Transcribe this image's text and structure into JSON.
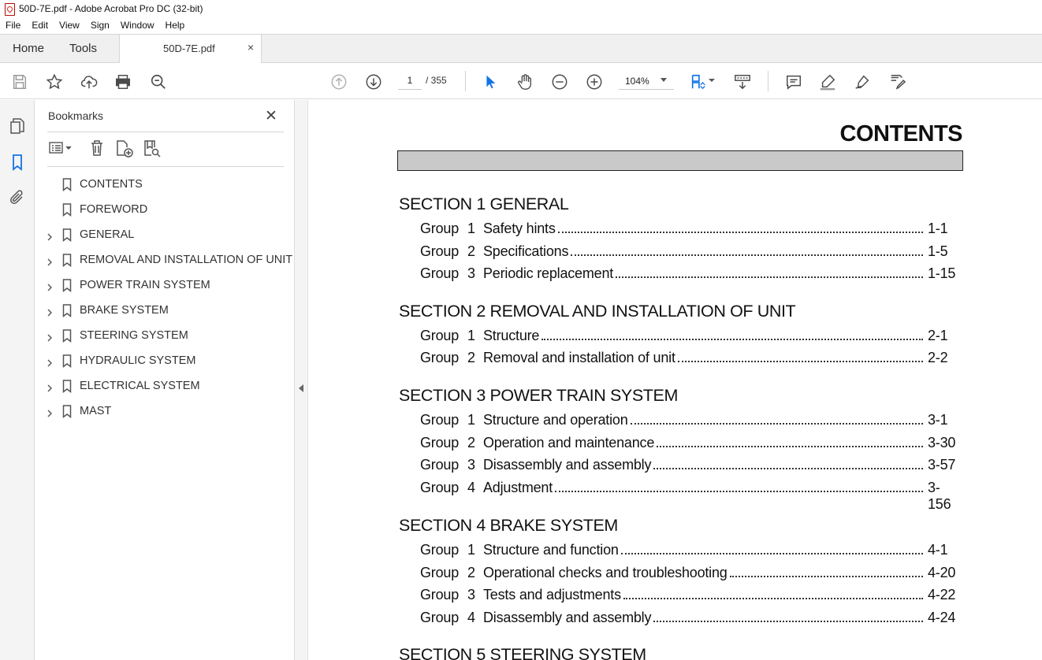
{
  "window": {
    "title": "50D-7E.pdf - Adobe Acrobat Pro DC (32-bit)"
  },
  "menu": [
    "File",
    "Edit",
    "View",
    "Sign",
    "Window",
    "Help"
  ],
  "tabs": {
    "home": "Home",
    "tools": "Tools",
    "document": "50D-7E.pdf",
    "close_glyph": "×"
  },
  "toolbar": {
    "page_current": "1",
    "page_total": "/ 355",
    "zoom": "104%",
    "icons": [
      "save-icon",
      "star-icon",
      "upload-icon",
      "print-icon",
      "search-zoom-icon",
      "page-up-icon",
      "page-down-icon",
      "select-cursor-icon",
      "hand-icon",
      "zoom-out-icon",
      "zoom-in-icon",
      "fit-page-icon",
      "scroll-mode-icon",
      "comment-icon",
      "highlight-icon",
      "sign-icon",
      "edit-icon"
    ]
  },
  "bookmarks": {
    "title": "Bookmarks",
    "close_glyph": "✕",
    "items": [
      {
        "label": "CONTENTS",
        "expandable": false
      },
      {
        "label": "FOREWORD",
        "expandable": false
      },
      {
        "label": "GENERAL",
        "expandable": true
      },
      {
        "label": "REMOVAL AND INSTALLATION OF UNIT",
        "expandable": true
      },
      {
        "label": "POWER TRAIN SYSTEM",
        "expandable": true
      },
      {
        "label": "BRAKE SYSTEM",
        "expandable": true
      },
      {
        "label": "STEERING SYSTEM",
        "expandable": true
      },
      {
        "label": "HYDRAULIC SYSTEM",
        "expandable": true
      },
      {
        "label": "ELECTRICAL SYSTEM",
        "expandable": true
      },
      {
        "label": "MAST",
        "expandable": true
      }
    ]
  },
  "document": {
    "heading": "CONTENTS",
    "sections": [
      {
        "title": "SECTION 1  GENERAL",
        "groups": [
          {
            "group": "Group",
            "num": "1",
            "title": "Safety hints",
            "page": "1-1"
          },
          {
            "group": "Group",
            "num": "2",
            "title": "Specifications",
            "page": "1-5"
          },
          {
            "group": "Group",
            "num": "3",
            "title": "Periodic replacement",
            "page": "1-15"
          }
        ]
      },
      {
        "title": "SECTION 2  REMOVAL AND INSTALLATION OF UNIT",
        "groups": [
          {
            "group": "Group",
            "num": "1",
            "title": "Structure",
            "page": "2-1"
          },
          {
            "group": "Group",
            "num": "2",
            "title": "Removal and installation of unit",
            "page": "2-2"
          }
        ]
      },
      {
        "title": "SECTION 3  POWER TRAIN SYSTEM",
        "groups": [
          {
            "group": "Group",
            "num": "1",
            "title": "Structure and operation",
            "page": "3-1"
          },
          {
            "group": "Group",
            "num": "2",
            "title": "Operation and maintenance",
            "page": "3-30"
          },
          {
            "group": "Group",
            "num": "3",
            "title": "Disassembly and assembly",
            "page": "3-57"
          },
          {
            "group": "Group",
            "num": "4",
            "title": "Adjustment",
            "page": "3-156"
          }
        ]
      },
      {
        "title": "SECTION 4  BRAKE SYSTEM",
        "groups": [
          {
            "group": "Group",
            "num": "1",
            "title": "Structure and function",
            "page": "4-1"
          },
          {
            "group": "Group",
            "num": "2",
            "title": "Operational checks and troubleshooting",
            "page": "4-20"
          },
          {
            "group": "Group",
            "num": "3",
            "title": "Tests and adjustments",
            "page": "4-22"
          },
          {
            "group": "Group",
            "num": "4",
            "title": "Disassembly and assembly",
            "page": "4-24"
          }
        ]
      },
      {
        "title": "SECTION 5  STEERING SYSTEM",
        "groups": []
      }
    ]
  },
  "colors": {
    "accent_blue": "#1473e6",
    "chrome_bg": "#f0f0f0",
    "header_bar_fill": "#c9c9c9"
  }
}
